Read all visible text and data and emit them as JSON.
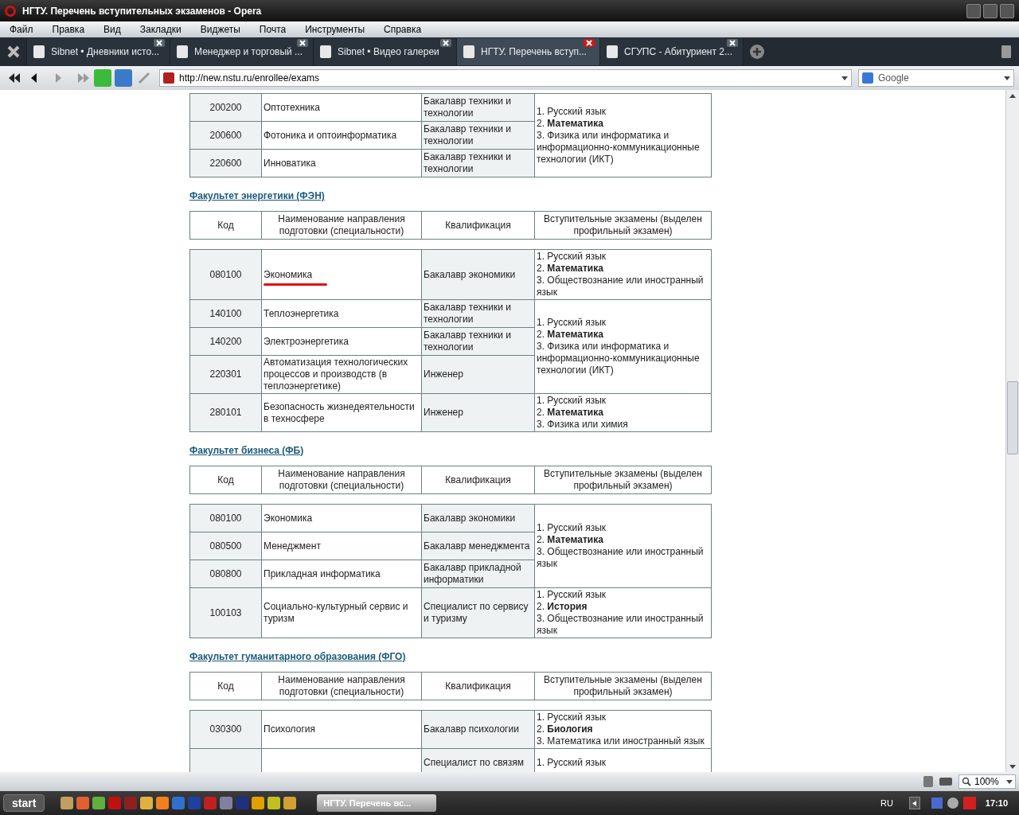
{
  "window": {
    "title": "НГТУ. Перечень вступительных экзаменов - Opera"
  },
  "menu": [
    "Файл",
    "Правка",
    "Вид",
    "Закладки",
    "Виджеты",
    "Почта",
    "Инструменты",
    "Справка"
  ],
  "tabs": [
    {
      "label": "Sibnet • Дневники исто...",
      "selected": false
    },
    {
      "label": "Менеджер и торговый ...",
      "selected": false
    },
    {
      "label": "Sibnet • Видео галереи",
      "selected": false
    },
    {
      "label": "НГТУ. Перечень вступ...",
      "selected": true
    },
    {
      "label": "СГУПС - Абитуриент 2...",
      "selected": false
    }
  ],
  "address": {
    "value": "http://new.nstu.ru/enrollee/exams"
  },
  "search": {
    "engine": "Google"
  },
  "sections": [
    {
      "groups": [
        {
          "exams": [
            "1. Русский язык",
            "2. **Математика**",
            "3. Физика или информатика и информационно-коммуникационные технологии (ИКТ)"
          ],
          "rows": [
            {
              "code": "200200",
              "name": "Оптотехника",
              "qualification": "Бакалавр техники и технологии"
            },
            {
              "code": "200600",
              "name": "Фотоника и оптоинформатика",
              "qualification": "Бакалавр техники и технологии"
            },
            {
              "code": "220600",
              "name": "Инноватика",
              "qualification": "Бакалавр техники и технологии"
            }
          ]
        }
      ]
    },
    {
      "heading": "Факультет энергетики (ФЭН)",
      "header": [
        "Код",
        "Наименование направления подготовки (специальности)",
        "Квалификация",
        "Вступительные экзамены (выделен профильный экзамен)"
      ],
      "groups": [
        {
          "exams": [
            "1. Русский язык",
            "2. **Математика**",
            "3. Обществознание или иностранный язык"
          ],
          "rows": [
            {
              "code": "080100",
              "name": "Экономика",
              "qualification": "Бакалавр экономики",
              "underlined": true
            }
          ]
        },
        {
          "exams": [
            "1. Русский язык",
            "2. **Математика**",
            "3. Физика или информатика и информационно-коммуникационные технологии (ИКТ)"
          ],
          "rows": [
            {
              "code": "140100",
              "name": "Теплоэнергетика",
              "qualification": "Бакалавр техники и технологии",
              "underlined": false
            },
            {
              "code": "140200",
              "name": "Электроэнергетика",
              "qualification": "Бакалавр техники и технологии",
              "underlined": false
            },
            {
              "code": "220301",
              "name": "Автоматизация технологических процессов и производств (в теплоэнергетике)",
              "qualification": "Инженер",
              "underlined": false
            }
          ]
        },
        {
          "exams": [
            "1. Русский язык",
            "2. **Математика**",
            "3. Физика или химия"
          ],
          "rows": [
            {
              "code": "280101",
              "name": "Безопасность жизнедеятельности в техносфере",
              "qualification": "Инженер",
              "underlined": false
            }
          ]
        }
      ]
    },
    {
      "heading": "Факультет бизнеса (ФБ)",
      "header": [
        "Код",
        "Наименование направления подготовки (специальности)",
        "Квалификация",
        "Вступительные экзамены (выделен профильный экзамен)"
      ],
      "groups": [
        {
          "exams": [
            "1. Русский язык",
            "2. **Математика**",
            "3. Обществознание или иностранный язык"
          ],
          "rows": [
            {
              "code": "080100",
              "name": "Экономика",
              "qualification": "Бакалавр экономики"
            },
            {
              "code": "080500",
              "name": "Менеджмент",
              "qualification": "Бакалавр менеджмента"
            },
            {
              "code": "080800",
              "name": "Прикладная информатика",
              "qualification": "Бакалавр прикладной информатики"
            }
          ]
        },
        {
          "exams": [
            "1. Русский язык",
            "2. **История**",
            "3. Обществознание или иностранный язык"
          ],
          "rows": [
            {
              "code": "100103",
              "name": "Социально-культурный сервис и туризм",
              "qualification": "Специалист по сервису и туризму"
            }
          ]
        }
      ]
    },
    {
      "heading": "Факультет гуманитарного образования (ФГО)",
      "header": [
        "Код",
        "Наименование направления подготовки (специальности)",
        "Квалификация",
        "Вступительные экзамены (выделен профильный экзамен)"
      ],
      "groups": [
        {
          "exams": [
            "1. Русский язык",
            "2. **Биология**",
            "3. Математика или иностранный язык"
          ],
          "rows": [
            {
              "code": "030300",
              "name": "Психология",
              "qualification": "Бакалавр психологии"
            }
          ]
        },
        {
          "exams": [
            "1. Русский язык"
          ],
          "rows": [
            {
              "qualification": "Специалист по связям"
            }
          ]
        }
      ]
    }
  ],
  "status": {
    "zoom": "100%"
  },
  "taskbar": {
    "start": "start",
    "task": "НГТУ. Перечень вс...",
    "language": "RU",
    "clock": "17:10"
  }
}
